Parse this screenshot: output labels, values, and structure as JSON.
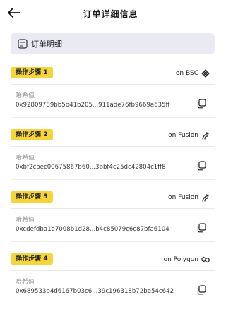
{
  "header": {
    "title": "订单详细信息",
    "back_icon": "arrow-left-icon"
  },
  "section": {
    "label": "订单明细",
    "icon": "document-icon"
  },
  "steps": [
    {
      "badge": "操作步骤 1",
      "network": "on BSC",
      "network_icon": "bsc-icon",
      "hash_label": "哈希值",
      "hash": "0x92809789bb5b41b205...911ade76fb9669a635ff"
    },
    {
      "badge": "操作步骤 2",
      "network": "on Fusion",
      "network_icon": "fusion-icon",
      "hash_label": "哈希值",
      "hash": "0xbf2cbec00675867b60...3bbf4c25dc42804c1ff8"
    },
    {
      "badge": "操作步骤 3",
      "network": "on Fusion",
      "network_icon": "fusion-icon",
      "hash_label": "哈希值",
      "hash": "0xcdefdba1e7008b1d28...b4c85079c6c87bfa6104"
    },
    {
      "badge": "操作步骤 4",
      "network": "on Polygon",
      "network_icon": "polygon-icon",
      "hash_label": "哈希值",
      "hash": "0x689533b4d6167b03c6...39c196318b72be54c642"
    }
  ],
  "colors": {
    "badge": "#f6d53a",
    "section_bg": "#e9eaf2"
  }
}
